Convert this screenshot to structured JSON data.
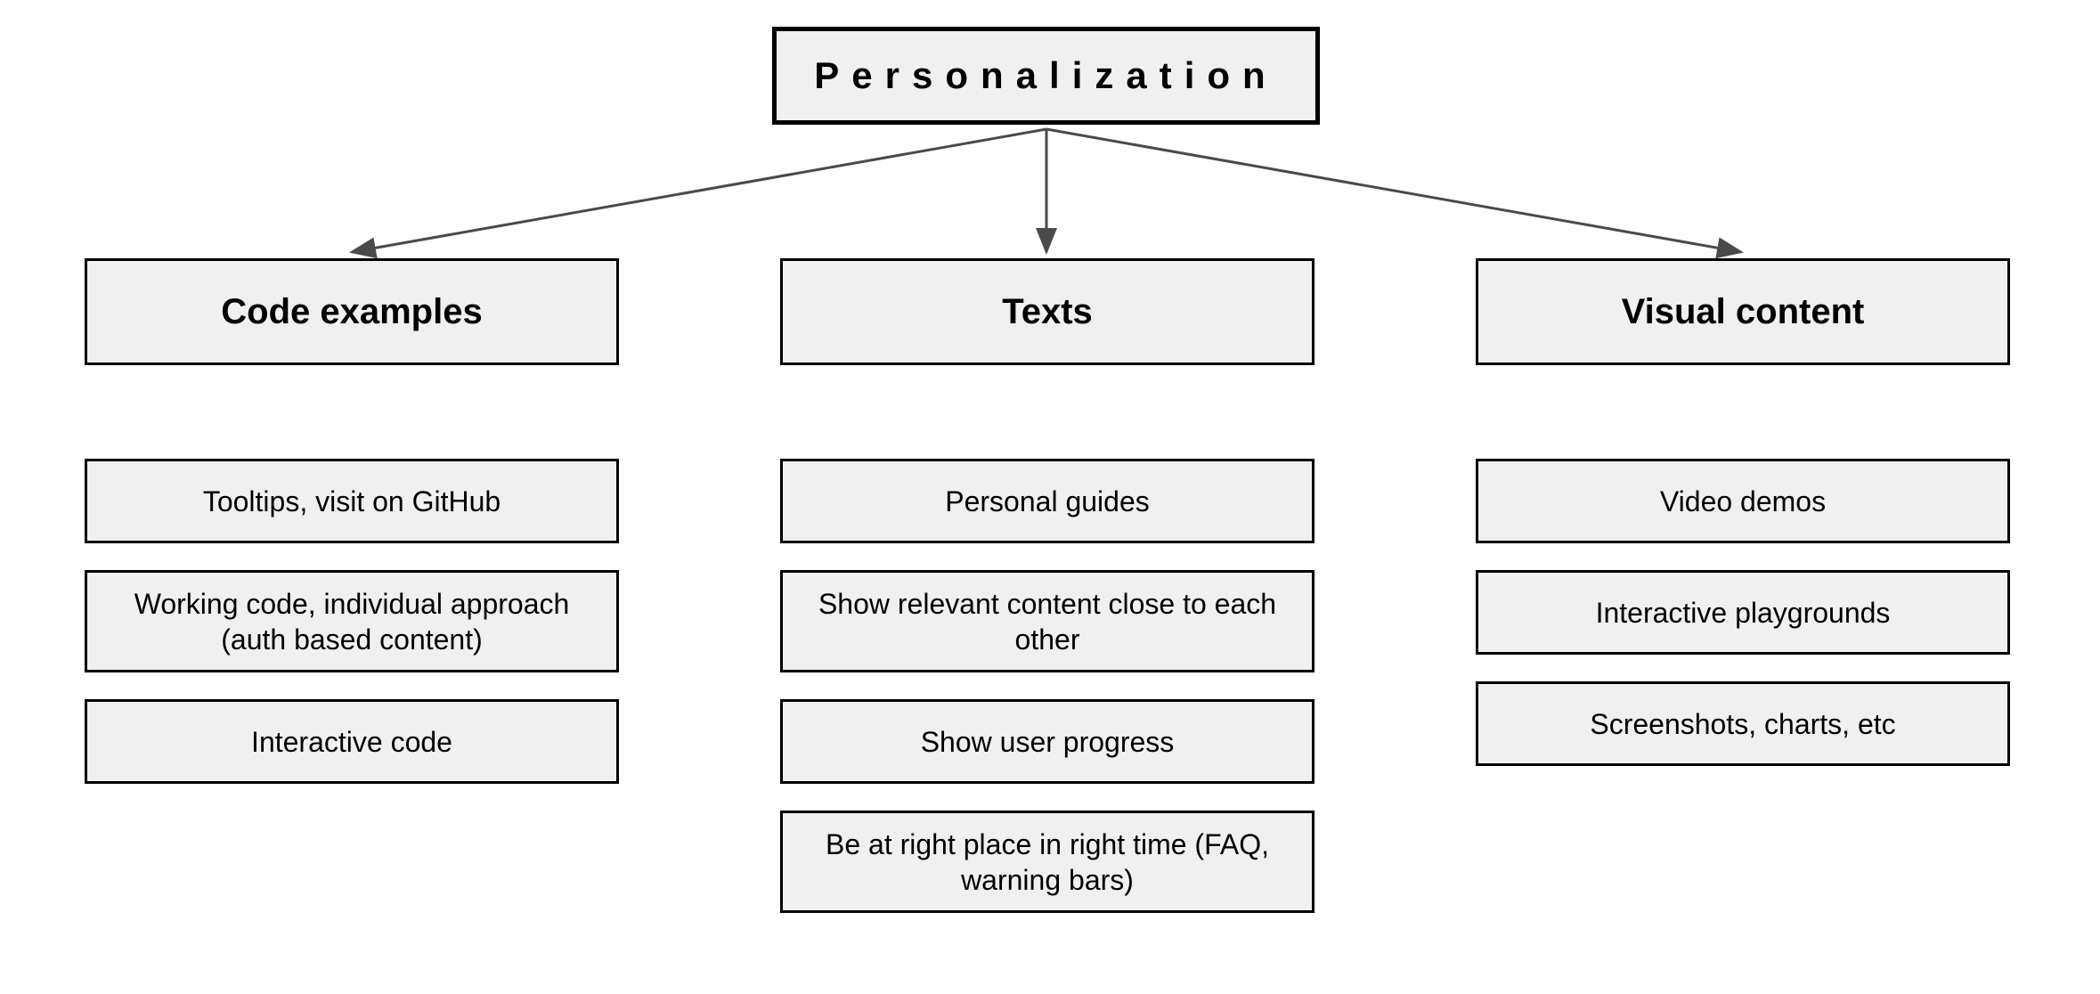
{
  "root": {
    "title": "Personalization"
  },
  "categories": [
    {
      "label": "Code examples"
    },
    {
      "label": "Texts"
    },
    {
      "label": "Visual content"
    }
  ],
  "columns": [
    {
      "items": [
        "Tooltips, visit on GitHub",
        "Working code, individual approach (auth based content)",
        "Interactive code"
      ]
    },
    {
      "items": [
        "Personal guides",
        "Show relevant content close to each other",
        "Show user progress",
        "Be at right place in right time (FAQ, warning bars)"
      ]
    },
    {
      "items": [
        "Video demos",
        "Interactive playgrounds",
        "Screenshots, charts, etc"
      ]
    }
  ]
}
